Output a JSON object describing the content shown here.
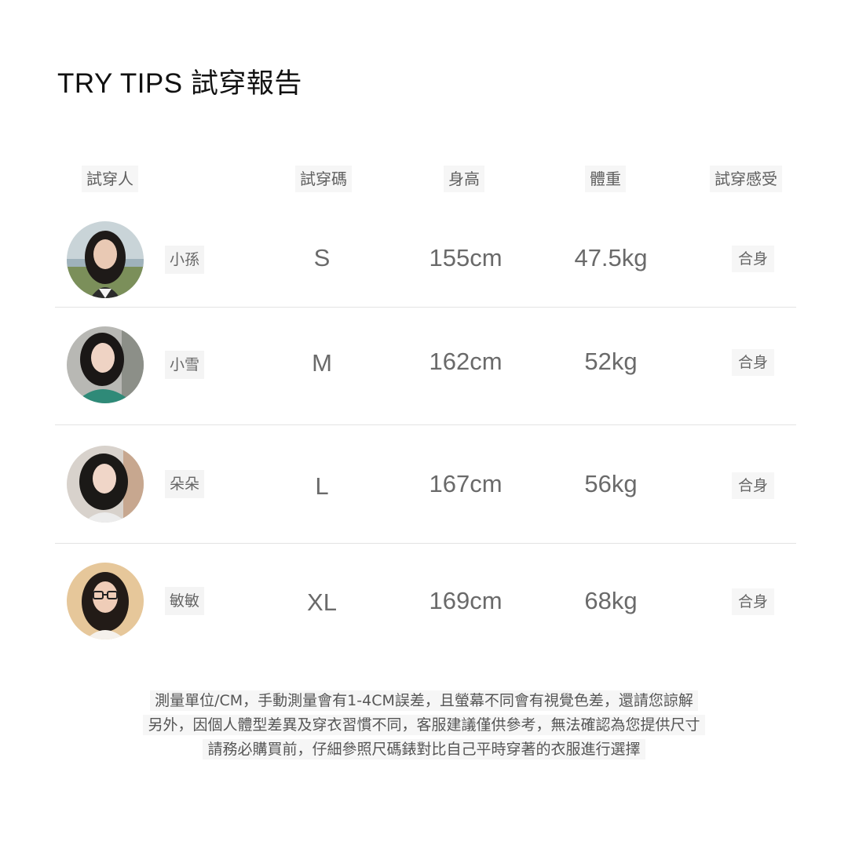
{
  "title": "TRY TIPS 試穿報告",
  "headers": {
    "person": "試穿人",
    "size": "試穿碼",
    "height": "身高",
    "weight": "體重",
    "feel": "試穿感受"
  },
  "rows": [
    {
      "name": "小孫",
      "size": "S",
      "height": "155cm",
      "weight": "47.5kg",
      "feel": "合身"
    },
    {
      "name": "小雪",
      "size": "M",
      "height": "162cm",
      "weight": "52kg",
      "feel": "合身"
    },
    {
      "name": "朵朵",
      "size": "L",
      "height": "167cm",
      "weight": "56kg",
      "feel": "合身"
    },
    {
      "name": "敏敏",
      "size": "XL",
      "height": "169cm",
      "weight": "68kg",
      "feel": "合身"
    }
  ],
  "notes": [
    "測量單位/CM，手動測量會有1-4CM誤差，且螢幕不同會有視覺色差，還請您諒解",
    "另外，因個人體型差異及穿衣習慣不同，客服建議僅供參考，無法確認為您提供尺寸",
    "請務必購買前，仔細參照尺碼錶對比自己平時穿著的衣服進行選擇"
  ]
}
